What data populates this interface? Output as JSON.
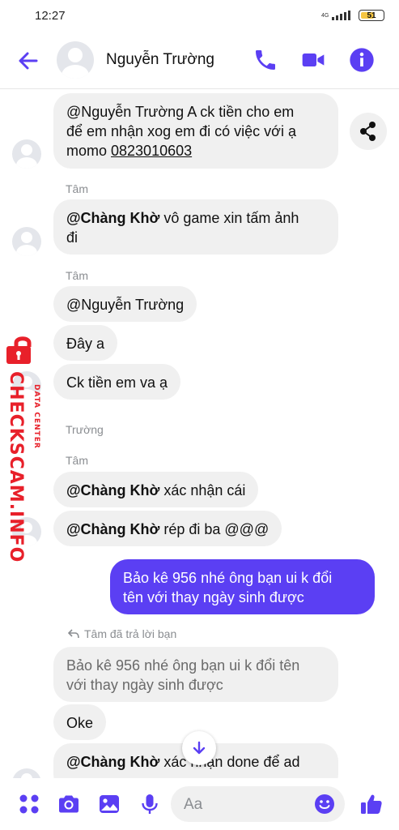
{
  "status_bar": {
    "time": "12:27",
    "network": "4G",
    "battery": "51"
  },
  "header": {
    "contact_name": "Nguyễn Trường"
  },
  "messages": {
    "m1": {
      "line1": "@Nguyễn Trường A ck tiền cho em",
      "line2": "để em nhận xog em đi có việc với ạ",
      "line3_prefix": "momo ",
      "phone": "0823010603"
    },
    "sender1": "Tâm",
    "m2": {
      "mention": "@Chàng Khờ",
      "line1": "  vô game xin tấm ảnh",
      "line2": "đi"
    },
    "sender2": "Tâm",
    "m3": "@Nguyễn Trường",
    "m4": "Đây a",
    "m5": "Ck tiền em va ạ",
    "sender3": "Trường",
    "sender4": "Tâm",
    "m6": {
      "mention": "@Chàng Khờ",
      "text": "  xác nhận cái"
    },
    "m7": {
      "mention": "@Chàng Khờ",
      "text": "  rép đi ba @@@"
    },
    "m8": {
      "line1": "Bảo kê 956 nhé ông bạn ui k đổi",
      "line2": "tên với thay ngày sinh được"
    },
    "reply_note": "Tâm đã trả lời bạn",
    "m9_quote": {
      "line1": "Bảo kê 956 nhé ông bạn ui k đổi tên",
      "line2": "với thay ngày sinh được"
    },
    "m10": "Oke",
    "m11": {
      "mention": "@Chàng Khờ",
      "text": " xác nhận done để ad"
    }
  },
  "composer": {
    "placeholder": "Aa"
  },
  "watermark": {
    "sub": "DATA CENTER",
    "main": "CHECKSCAM.INFO"
  },
  "colors": {
    "accent": "#5b3ff3",
    "bubble_in": "#f0f0f0",
    "watermark": "#e8202a"
  },
  "icons": {
    "header": [
      "back-arrow-icon",
      "phone-icon",
      "video-camera-icon",
      "info-icon"
    ],
    "composer": [
      "apps-icon",
      "camera-icon",
      "gallery-icon",
      "microphone-icon",
      "emoji-icon",
      "thumbs-up-icon"
    ],
    "misc": [
      "share-icon",
      "reply-arrow-icon",
      "arrow-down-icon",
      "lock-icon"
    ]
  }
}
